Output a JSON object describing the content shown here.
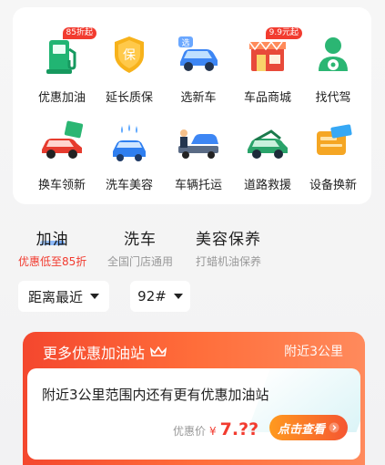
{
  "services": [
    {
      "label": "优惠加油",
      "icon": "fuel-pump-icon",
      "badge": "85折起"
    },
    {
      "label": "延长质保",
      "icon": "warranty-shield-icon",
      "badge": ""
    },
    {
      "label": "选新车",
      "icon": "new-car-icon",
      "badge": ""
    },
    {
      "label": "车品商城",
      "icon": "shop-icon",
      "badge": "9.9元起"
    },
    {
      "label": "找代驾",
      "icon": "driver-icon",
      "badge": ""
    },
    {
      "label": "换车领新",
      "icon": "car-trade-icon",
      "badge": ""
    },
    {
      "label": "洗车美容",
      "icon": "car-wash-icon",
      "badge": ""
    },
    {
      "label": "车辆托运",
      "icon": "tow-truck-icon",
      "badge": ""
    },
    {
      "label": "道路救援",
      "icon": "road-rescue-icon",
      "badge": ""
    },
    {
      "label": "设备换新",
      "icon": "device-card-icon",
      "badge": ""
    }
  ],
  "icon_glyphs": {
    "shield_char": "保",
    "new_car_tag": "选"
  },
  "tabs": [
    {
      "title": "加油",
      "subtitle": "优惠低至85折",
      "active": true
    },
    {
      "title": "洗车",
      "subtitle": "全国门店通用",
      "active": false
    },
    {
      "title": "美容保养",
      "subtitle": "打蜡机油保养",
      "active": false
    }
  ],
  "filters": {
    "sort_label": "距离最近",
    "fuel_label": "92#"
  },
  "promo": {
    "title": "更多优惠加油站",
    "distance": "附近3公里",
    "description": "附近3公里范围内还有更有优惠加油站",
    "price_label": "优惠价",
    "currency": "¥",
    "price_value": "7.??",
    "cta_label": "点击查看"
  },
  "colors": {
    "accent_red": "#f23b2f",
    "accent_orange": "#ff7a3a",
    "tab_underline": "#4a8ff7"
  }
}
